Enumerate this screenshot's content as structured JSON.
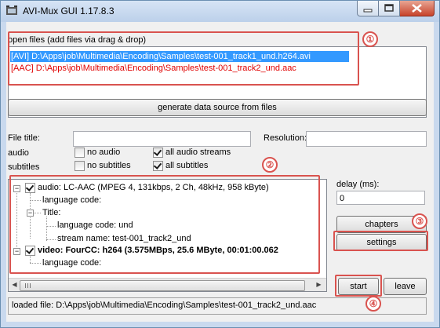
{
  "window": {
    "title": "AVI-Mux GUI 1.17.8.3"
  },
  "open_files": {
    "label": "open files (add files via drag & drop)",
    "items": [
      "[AVI] D:\\Apps\\job\\Multimedia\\Encoding\\Samples\\test-001_track1_und.h264.avi",
      "[AAC] D:\\Apps\\job\\Multimedia\\Encoding\\Samples\\test-001_track2_und.aac"
    ]
  },
  "generate_button": "generate data source from files",
  "fields": {
    "file_title_label": "File title:",
    "file_title_value": "",
    "resolution_label": "Resolution:",
    "resolution_value": ""
  },
  "audio": {
    "label": "audio",
    "no_audio": "no audio",
    "all_streams": "all audio streams"
  },
  "subtitles": {
    "label": "subtitles",
    "no_subtitles": "no subtitles",
    "all_subtitles": "all subtitles"
  },
  "tree": {
    "audio_stream": "audio: LC-AAC (MPEG 4, 131kbps, 2 Ch, 48kHz, 958 kByte)",
    "audio_lang": "language code:",
    "title": "Title:",
    "title_lang": "language code: und",
    "stream_name": "stream name: test-001_track2_und",
    "video_stream": "video: FourCC: h264 (3.575MBps, 25.6 MByte, 00:01:00.062",
    "video_lang": "language code:"
  },
  "delay": {
    "label": "delay (ms):",
    "value": "0"
  },
  "buttons": {
    "chapters": "chapters",
    "settings": "settings",
    "start": "start",
    "leave": "leave"
  },
  "status": "loaded file: D:\\Apps\\job\\Multimedia\\Encoding\\Samples\\test-001_track2_und.aac",
  "annotations": [
    "①",
    "②",
    "③",
    "④"
  ],
  "colors": {
    "annotation": "#d9534f",
    "selection": "#3399ff",
    "list_text": "#e00000"
  }
}
